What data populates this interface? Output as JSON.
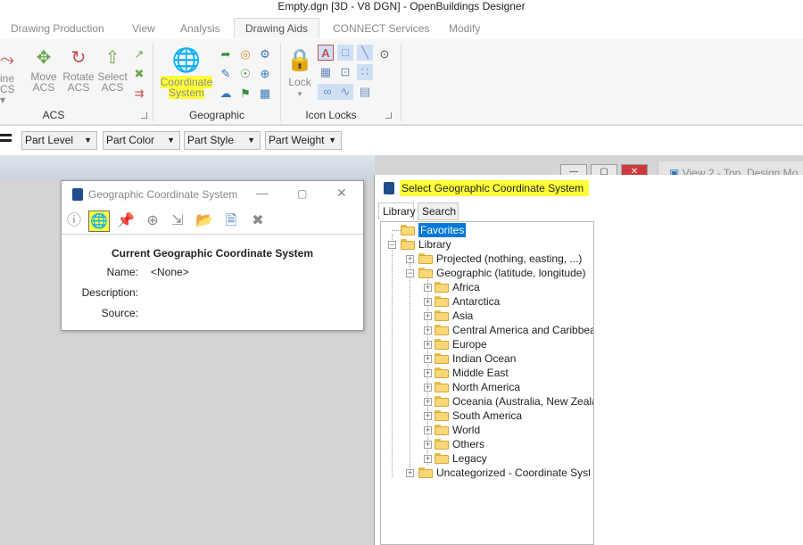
{
  "window": {
    "title": "Empty.dgn [3D - V8 DGN] - OpenBuildings Designer"
  },
  "ribbon": {
    "tabs": [
      "Drawing Production",
      "View",
      "Analysis",
      "Drawing Aids",
      "CONNECT Services",
      "Modify"
    ],
    "active_tab": "Drawing Aids",
    "acs_group": {
      "label": "ACS",
      "partial_button_line1": "ine",
      "partial_button_line2": "CS ▾",
      "move_acs": [
        "Move",
        "ACS"
      ],
      "rotate_acs": [
        "Rotate",
        "ACS"
      ],
      "select_acs": [
        "Select",
        "ACS"
      ]
    },
    "geographic_group": {
      "label": "Geographic",
      "coordinate_system": [
        "Coordinate",
        "System"
      ]
    },
    "icon_locks_group": {
      "label": "Icon Locks",
      "lock": "Lock"
    }
  },
  "attribute_toolbar": {
    "part_level": "Part Level",
    "part_color": "Part Color",
    "part_style": "Part Style",
    "part_weight": "Part Weight"
  },
  "gcs_dialog": {
    "title": "Geographic Coordinate System",
    "heading": "Current Geographic Coordinate System",
    "name_label": "Name:",
    "name_value": "<None>",
    "description_label": "Description:",
    "description_value": "",
    "source_label": "Source:",
    "source_value": ""
  },
  "select_dialog": {
    "title": "Select Geographic Coordinate System",
    "tabs": [
      "Library",
      "Search"
    ],
    "active_tab": "Library",
    "tree": {
      "favorites": "Favorites",
      "library": "Library",
      "projected": "Projected (nothing, easting, ...)",
      "geographic": "Geographic (latitude, longitude)",
      "regions": [
        "Africa",
        "Antarctica",
        "Asia",
        "Central America and Caribbean",
        "Europe",
        "Indian Ocean",
        "Middle East",
        "North America",
        "Oceania (Australia, New Zealand",
        "South America",
        "World",
        "Others",
        "Legacy"
      ],
      "uncategorized": "Uncategorized - Coordinate Systems r"
    }
  },
  "view2": {
    "title": "View 2 - Top, Design Mo"
  },
  "colors": {
    "highlight": "#ffff3a",
    "selection": "#0078d7",
    "folder": "#f9d776"
  },
  "icons": [
    "globe-icon",
    "lock-icon",
    "folder-icon",
    "pin-icon",
    "close-icon",
    "minimize-icon",
    "maximize-icon",
    "info-icon"
  ]
}
